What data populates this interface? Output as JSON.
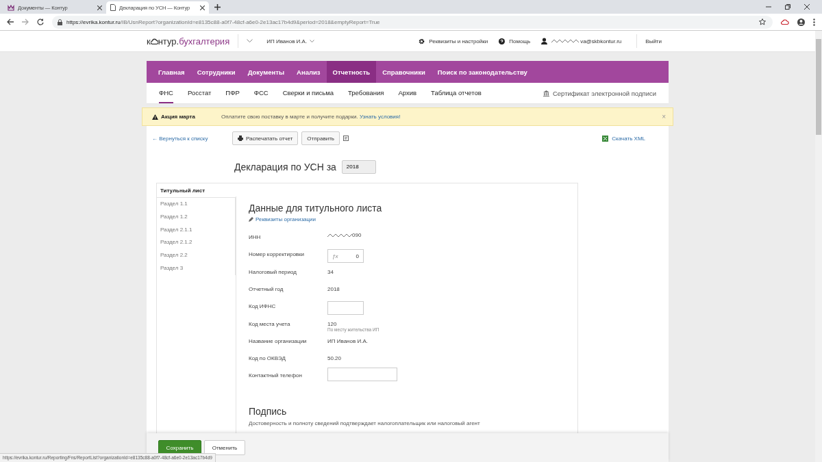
{
  "browser": {
    "tabs": [
      {
        "title": "Документы — Контур",
        "selected": false
      },
      {
        "title": "Декларация по УСН — Контур",
        "selected": true
      }
    ],
    "url_host": "https://evrika.kontur.ru",
    "url_path": "/IB/UsnReport?organizationId=e8135c88-a0f7-48cf-a6e0-2e13ac17b4d9&period=2018&emptyReport=True"
  },
  "site_header": {
    "logo_prefix": "к",
    "logo_middle": "нтур.",
    "logo_suffix": "бухгалтерия",
    "organization": "ИП Иванов И.А.",
    "settings": "Реквизиты и настройки",
    "help": "Помощь",
    "user_email": "va@skbkontur.ru",
    "logout": "Выйти"
  },
  "main_nav": [
    {
      "label": "Главная",
      "selected": false
    },
    {
      "label": "Сотрудники",
      "selected": false
    },
    {
      "label": "Документы",
      "selected": false
    },
    {
      "label": "Анализ",
      "selected": false
    },
    {
      "label": "Отчетность",
      "selected": true
    },
    {
      "label": "Справочники",
      "selected": false
    },
    {
      "label": "Поиск по законодательству",
      "selected": false
    }
  ],
  "sub_nav": [
    {
      "label": "ФНС",
      "selected": true
    },
    {
      "label": "Росстат",
      "selected": false
    },
    {
      "label": "ПФР",
      "selected": false
    },
    {
      "label": "ФСС",
      "selected": false
    },
    {
      "label": "Сверки и письма",
      "selected": false
    },
    {
      "label": "Требования",
      "selected": false
    },
    {
      "label": "Архив",
      "selected": false
    },
    {
      "label": "Таблица отчетов",
      "selected": false
    }
  ],
  "certificate_link": "Сертификат электронной подписи",
  "alert": {
    "title": "Акция марта",
    "message": "Оплатите свою поставку в марте и получите подарки.",
    "link": "Узнать условия!",
    "close": "×"
  },
  "toolbar": {
    "back": "← Вернуться к списку",
    "print": "Распечатать отчет",
    "send": "Отправить",
    "download": "Скачать XML"
  },
  "report_title": "Декларация по УСН за",
  "year": "2018",
  "sections": [
    {
      "label": "Титульный лист",
      "selected": true
    },
    {
      "label": "Раздел 1.1",
      "selected": false
    },
    {
      "label": "Раздел 1.2",
      "selected": false
    },
    {
      "label": "Раздел 2.1.1",
      "selected": false
    },
    {
      "label": "Раздел 2.1.2",
      "selected": false
    },
    {
      "label": "Раздел 2.2",
      "selected": false
    },
    {
      "label": "Раздел 3",
      "selected": false
    }
  ],
  "form": {
    "heading": "Данные для титульного листа",
    "org_link": "Реквизиты организации",
    "fields": [
      {
        "kind": "masked",
        "label": "ИНН",
        "value": "090"
      },
      {
        "kind": "formula",
        "label": "Номер корректировки",
        "prefix": "ƒx",
        "value": "0"
      },
      {
        "kind": "text",
        "label": "Налоговый период",
        "value": "34"
      },
      {
        "kind": "text",
        "label": "Отчетный год",
        "value": "2018"
      },
      {
        "kind": "input",
        "label": "Код ИФНС"
      },
      {
        "kind": "text",
        "label": "Код места учета",
        "value": "120",
        "note": "По месту жительства ИП"
      },
      {
        "kind": "text",
        "label": "Название организации",
        "value": "ИП Иванов И.А."
      },
      {
        "kind": "text",
        "label": "Код по ОКВЭД",
        "value": "50.20"
      },
      {
        "kind": "wide_input",
        "label": "Контактный телефон"
      }
    ],
    "signature_heading": "Подпись",
    "signature_text": "Достоверность и полноту сведений подтверждает налогоплательщик или налоговый агент"
  },
  "footer": {
    "save": "Сохранить",
    "cancel": "Отменить"
  },
  "status_bar": "https://evrika.kontur.ru/Reporting/Fns/ReportList?organizationId=e8135c88-a0f7-48cf-a6e0-2e13ac17b4d9"
}
